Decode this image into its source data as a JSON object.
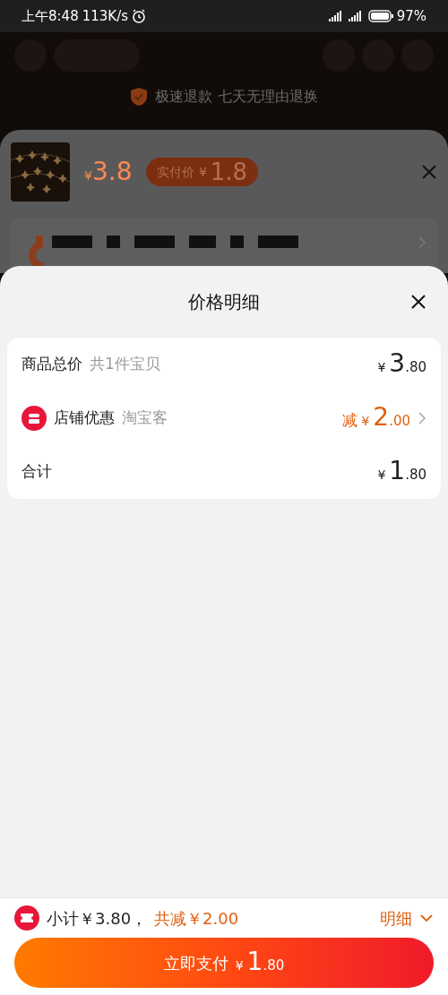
{
  "status_bar": {
    "time": "上午8:48",
    "speed": "113K/s",
    "battery": "97%"
  },
  "background": {
    "guarantee": "极速退款 七天无理由退换",
    "price": {
      "currency": "¥",
      "amount": "3.8"
    },
    "badge": {
      "label": "实付价",
      "currency": "¥",
      "amount": "1.8"
    }
  },
  "sheet": {
    "title": "价格明细",
    "rows": [
      {
        "kind": "plain",
        "label": "商品总价",
        "note": "共1件宝贝",
        "prefix": "",
        "currency": "¥",
        "int": "3",
        "dec": ".80",
        "accent": false,
        "chevron": false
      },
      {
        "kind": "icon",
        "label": "店铺优惠",
        "note": "淘宝客",
        "prefix": "减",
        "currency": "¥",
        "int": "2",
        "dec": ".00",
        "accent": true,
        "chevron": true
      },
      {
        "kind": "plain",
        "label": "合计",
        "note": "",
        "prefix": "",
        "currency": "¥",
        "int": "1",
        "dec": ".80",
        "accent": false,
        "chevron": false
      }
    ]
  },
  "footer": {
    "subtotal": "小计￥3.80，",
    "discount": "共减￥2.00",
    "detail": "明细",
    "pay": {
      "label": "立即支付",
      "currency": "¥",
      "int": "1",
      "dec": ".80"
    }
  }
}
